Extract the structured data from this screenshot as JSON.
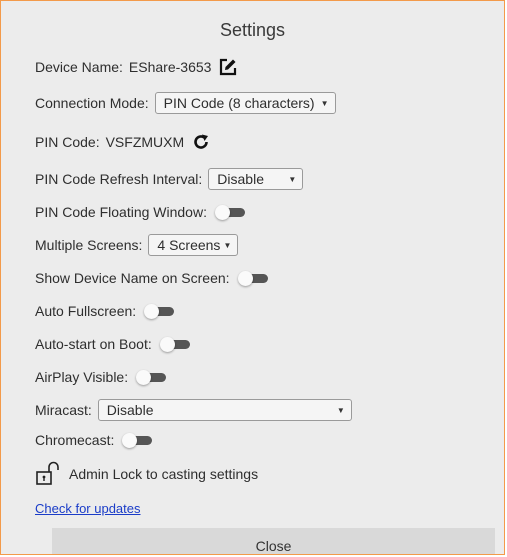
{
  "title": "Settings",
  "device_name": {
    "label": "Device Name:",
    "value": "EShare-3653",
    "icon": "edit-icon"
  },
  "connection_mode": {
    "label": "Connection Mode:",
    "value": "PIN Code (8 characters)"
  },
  "pin_code": {
    "label": "PIN Code:",
    "value": "VSFZMUXM",
    "icon": "refresh-icon"
  },
  "pin_refresh": {
    "label": "PIN Code Refresh Interval:",
    "value": "Disable"
  },
  "pin_floating": {
    "label": "PIN Code Floating Window:",
    "on": false
  },
  "multiple_screens": {
    "label": "Multiple Screens:",
    "value": "4 Screens"
  },
  "show_device_name": {
    "label": "Show Device Name on Screen:",
    "on": false
  },
  "auto_fullscreen": {
    "label": "Auto Fullscreen:",
    "on": false
  },
  "auto_start": {
    "label": "Auto-start on Boot:",
    "on": false
  },
  "airplay": {
    "label": "AirPlay Visible:",
    "on": false
  },
  "miracast": {
    "label": "Miracast:",
    "value": "Disable"
  },
  "chromecast": {
    "label": "Chromecast:",
    "on": false
  },
  "admin_lock": {
    "label": "Admin Lock to casting settings",
    "icon": "unlock-icon"
  },
  "check_updates": "Check for updates",
  "close": "Close",
  "colors": {
    "border": "#f39a4a",
    "link": "#1a3cc8",
    "panel": "#ececec"
  }
}
